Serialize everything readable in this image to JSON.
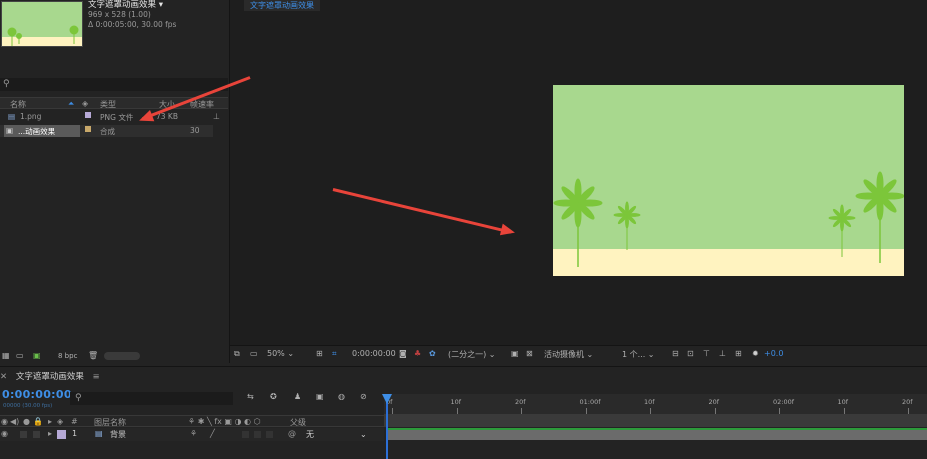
{
  "project": {
    "comp_name": "文字遮罩动画效果 ▾",
    "comp_size": "969 x 528 (1.00)",
    "comp_duration": "Δ 0:00:05:00, 30.00 fps",
    "search_icon": "search-icon",
    "columns": {
      "name": "名称",
      "type": "类型",
      "size": "大小",
      "frame_rate": "帧速率"
    },
    "items": [
      {
        "name": "1.png",
        "type": "PNG 文件",
        "size": "73 KB",
        "frame_rate": "",
        "label_color": "#b6a9d6"
      },
      {
        "name": "...动画效果",
        "type": "合成",
        "size": "",
        "frame_rate": "30",
        "label_color": "#c8a86a"
      }
    ],
    "bpc": "8 bpc"
  },
  "viewer": {
    "tab_label": "文字遮罩动画效果",
    "colors": {
      "sky": "#a8d88e",
      "sand": "#fff3c0",
      "plant": "#7cc63a"
    },
    "toolbar": {
      "zoom": "50%",
      "timecode": "0:00:00:00",
      "resolution": "(二分之一)",
      "camera": "活动摄像机",
      "views": "1 个...",
      "exposure": "+0.0"
    }
  },
  "timeline": {
    "tab_label": "文字遮罩动画效果",
    "timecode": "0:00:00:00",
    "timecode_sub": "00000 (30.00 fps)",
    "columns": {
      "layer_name": "图层名称",
      "parent": "父级"
    },
    "layer": {
      "index": "1",
      "name": "背景",
      "parent": "无",
      "label_color": "#b6a9d6"
    },
    "ruler_ticks": [
      "0f",
      "10f",
      "20f",
      "01:00f",
      "10f",
      "20f",
      "02:00f",
      "10f",
      "20f"
    ]
  },
  "accent_colors": {
    "blue": "#3e8ee6",
    "arrow": "#e8443a",
    "green": "#2c9a3a"
  }
}
